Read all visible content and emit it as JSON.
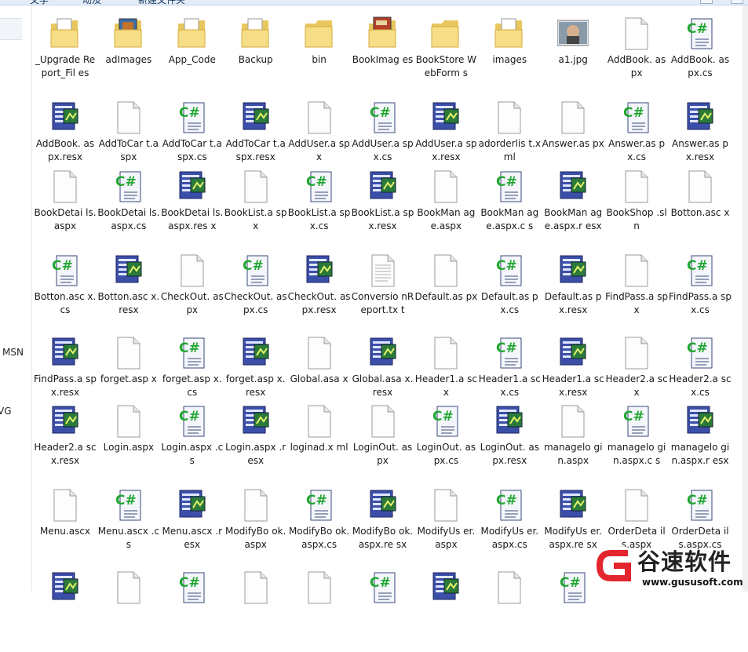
{
  "toolbar": {
    "items": [
      "文学",
      "动及",
      "新建文件夹"
    ]
  },
  "nav_pane": {
    "items": [
      "MSN",
      "VG"
    ]
  },
  "files": [
    {
      "name": "_UpgradeReport_Files",
      "label": "_Upgrade Report_Fil es",
      "type": "folder-doc"
    },
    {
      "name": "adImages",
      "label": "adImages",
      "type": "folder-pics"
    },
    {
      "name": "App_Code",
      "label": "App_Code",
      "type": "folder-doc"
    },
    {
      "name": "Backup",
      "label": "Backup",
      "type": "folder-doc"
    },
    {
      "name": "bin",
      "label": "bin",
      "type": "folder"
    },
    {
      "name": "BookImages",
      "label": "BookImag es",
      "type": "folder-book"
    },
    {
      "name": "BookStoreWebForms",
      "label": "BookStore WebForm s",
      "type": "folder"
    },
    {
      "name": "images",
      "label": "images",
      "type": "folder-doc"
    },
    {
      "name": "a1.jpg",
      "label": "a1.jpg",
      "type": "photo"
    },
    {
      "name": "AddBook.aspx",
      "label": "AddBook. aspx",
      "type": "blank"
    },
    {
      "name": "AddBook.aspx.cs",
      "label": "AddBook. aspx.cs",
      "type": "cs"
    },
    {
      "name": "AddBook.aspx.resx",
      "label": "AddBook. aspx.resx",
      "type": "resx"
    },
    {
      "name": "AddToCart.aspx",
      "label": "AddToCar t.aspx",
      "type": "blank"
    },
    {
      "name": "AddToCart.aspx.cs",
      "label": "AddToCar t.aspx.cs",
      "type": "cs"
    },
    {
      "name": "AddToCart.aspx.resx",
      "label": "AddToCar t.aspx.resx",
      "type": "resx"
    },
    {
      "name": "AddUser.aspx",
      "label": "AddUser.a spx",
      "type": "blank"
    },
    {
      "name": "AddUser.aspx.cs",
      "label": "AddUser.a spx.cs",
      "type": "cs"
    },
    {
      "name": "AddUser.aspx.resx",
      "label": "AddUser.a spx.resx",
      "type": "resx"
    },
    {
      "name": "adorderlist.xml",
      "label": "adorderlis t.xml",
      "type": "blank"
    },
    {
      "name": "Answer.aspx",
      "label": "Answer.as px",
      "type": "blank"
    },
    {
      "name": "Answer.aspx.cs",
      "label": "Answer.as px.cs",
      "type": "cs"
    },
    {
      "name": "Answer.aspx.resx",
      "label": "Answer.as px.resx",
      "type": "resx"
    },
    {
      "name": "BookDetails.aspx",
      "label": "BookDetai ls.aspx",
      "type": "blank"
    },
    {
      "name": "BookDetails.aspx.cs",
      "label": "BookDetai ls.aspx.cs",
      "type": "cs"
    },
    {
      "name": "BookDetails.aspx.resx",
      "label": "BookDetai ls.aspx.res x",
      "type": "resx"
    },
    {
      "name": "BookList.aspx",
      "label": "BookList.a spx",
      "type": "blank"
    },
    {
      "name": "BookList.aspx.cs",
      "label": "BookList.a spx.cs",
      "type": "cs"
    },
    {
      "name": "BookList.aspx.resx",
      "label": "BookList.a spx.resx",
      "type": "resx"
    },
    {
      "name": "BookManage.aspx",
      "label": "BookMan age.aspx",
      "type": "blank"
    },
    {
      "name": "BookManage.aspx.cs",
      "label": "BookMan age.aspx.c s",
      "type": "cs"
    },
    {
      "name": "BookManage.aspx.resx",
      "label": "BookMan age.aspx.r esx",
      "type": "resx"
    },
    {
      "name": "BookShop.sln",
      "label": "BookShop .sln",
      "type": "blank"
    },
    {
      "name": "Botton.ascx",
      "label": "Botton.asc x",
      "type": "blank"
    },
    {
      "name": "Botton.ascx.cs",
      "label": "Botton.asc x.cs",
      "type": "cs"
    },
    {
      "name": "Botton.ascx.resx",
      "label": "Botton.asc x.resx",
      "type": "resx"
    },
    {
      "name": "CheckOut.aspx",
      "label": "CheckOut. aspx",
      "type": "blank"
    },
    {
      "name": "CheckOut.aspx.cs",
      "label": "CheckOut. aspx.cs",
      "type": "cs"
    },
    {
      "name": "CheckOut.aspx.resx",
      "label": "CheckOut. aspx.resx",
      "type": "resx"
    },
    {
      "name": "ConversionReport.txt",
      "label": "Conversio nReport.tx t",
      "type": "text"
    },
    {
      "name": "Default.aspx",
      "label": "Default.as px",
      "type": "blank"
    },
    {
      "name": "Default.aspx.cs",
      "label": "Default.as px.cs",
      "type": "cs"
    },
    {
      "name": "Default.aspx.resx",
      "label": "Default.as px.resx",
      "type": "resx"
    },
    {
      "name": "FindPass.aspx",
      "label": "FindPass.a spx",
      "type": "blank"
    },
    {
      "name": "FindPass.aspx.cs",
      "label": "FindPass.a spx.cs",
      "type": "cs"
    },
    {
      "name": "FindPass.aspx.resx",
      "label": "FindPass.a spx.resx",
      "type": "resx"
    },
    {
      "name": "forget.aspx",
      "label": "forget.asp x",
      "type": "blank"
    },
    {
      "name": "forget.aspx.cs",
      "label": "forget.asp x.cs",
      "type": "cs"
    },
    {
      "name": "forget.aspx.resx",
      "label": "forget.asp x.resx",
      "type": "resx"
    },
    {
      "name": "Global.asax",
      "label": "Global.asa x",
      "type": "blank"
    },
    {
      "name": "Global.asax.resx",
      "label": "Global.asa x.resx",
      "type": "resx"
    },
    {
      "name": "Header1.ascx",
      "label": "Header1.a scx",
      "type": "blank"
    },
    {
      "name": "Header1.ascx.cs",
      "label": "Header1.a scx.cs",
      "type": "cs"
    },
    {
      "name": "Header1.ascx.resx",
      "label": "Header1.a scx.resx",
      "type": "resx"
    },
    {
      "name": "Header2.ascx",
      "label": "Header2.a scx",
      "type": "blank"
    },
    {
      "name": "Header2.ascx.cs",
      "label": "Header2.a scx.cs",
      "type": "cs"
    },
    {
      "name": "Header2.ascx.resx",
      "label": "Header2.a scx.resx",
      "type": "resx"
    },
    {
      "name": "Login.aspx",
      "label": "Login.aspx",
      "type": "blank"
    },
    {
      "name": "Login.aspx.cs",
      "label": "Login.aspx .cs",
      "type": "cs"
    },
    {
      "name": "Login.aspx.resx",
      "label": "Login.aspx .resx",
      "type": "resx"
    },
    {
      "name": "loginad.xml",
      "label": "loginad.x ml",
      "type": "blank"
    },
    {
      "name": "LoginOut.aspx",
      "label": "LoginOut. aspx",
      "type": "blank"
    },
    {
      "name": "LoginOut.aspx.cs",
      "label": "LoginOut. aspx.cs",
      "type": "cs"
    },
    {
      "name": "LoginOut.aspx.resx",
      "label": "LoginOut. aspx.resx",
      "type": "resx"
    },
    {
      "name": "managelogin.aspx",
      "label": "managelo gin.aspx",
      "type": "blank"
    },
    {
      "name": "managelogin.aspx.cs",
      "label": "managelo gin.aspx.c s",
      "type": "cs"
    },
    {
      "name": "managelogin.aspx.resx",
      "label": "managelo gin.aspx.r esx",
      "type": "resx"
    },
    {
      "name": "Menu.ascx",
      "label": "Menu.ascx",
      "type": "blank"
    },
    {
      "name": "Menu.ascx.cs",
      "label": "Menu.ascx .cs",
      "type": "cs"
    },
    {
      "name": "Menu.ascx.resx",
      "label": "Menu.ascx .resx",
      "type": "resx"
    },
    {
      "name": "ModifyBook.aspx",
      "label": "ModifyBo ok.aspx",
      "type": "blank"
    },
    {
      "name": "ModifyBook.aspx.cs",
      "label": "ModifyBo ok.aspx.cs",
      "type": "cs"
    },
    {
      "name": "ModifyBook.aspx.resx",
      "label": "ModifyBo ok.aspx.re sx",
      "type": "resx"
    },
    {
      "name": "ModifyUser.aspx",
      "label": "ModifyUs er.aspx",
      "type": "blank"
    },
    {
      "name": "ModifyUser.aspx.cs",
      "label": "ModifyUs er.aspx.cs",
      "type": "cs"
    },
    {
      "name": "ModifyUser.aspx.resx",
      "label": "ModifyUs er.aspx.re sx",
      "type": "resx"
    },
    {
      "name": "OrderDetails.aspx",
      "label": "OrderDeta ils.aspx",
      "type": "blank"
    },
    {
      "name": "OrderDetails.aspx.cs",
      "label": "OrderDeta ils.aspx.cs",
      "type": "cs"
    },
    {
      "name": "row8-1",
      "label": "",
      "type": "resx"
    },
    {
      "name": "row8-2",
      "label": "",
      "type": "blank"
    },
    {
      "name": "row8-3",
      "label": "",
      "type": "cs"
    },
    {
      "name": "row8-4",
      "label": "",
      "type": "blank"
    },
    {
      "name": "row8-5",
      "label": "",
      "type": "blank"
    },
    {
      "name": "row8-6",
      "label": "",
      "type": "cs"
    },
    {
      "name": "row8-7",
      "label": "",
      "type": "resx"
    },
    {
      "name": "row8-8",
      "label": "",
      "type": "blank"
    },
    {
      "name": "row8-9",
      "label": "",
      "type": "cs"
    }
  ],
  "watermark": {
    "title": "谷速软件",
    "url": "www.gususoft.com"
  }
}
